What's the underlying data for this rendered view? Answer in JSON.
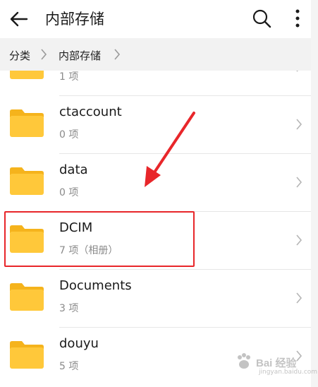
{
  "header": {
    "title": "内部存储"
  },
  "breadcrumb": {
    "root": "分类",
    "current": "内部存储"
  },
  "folders": [
    {
      "name": "",
      "count": "1 项"
    },
    {
      "name": "ctaccount",
      "count": "0 项"
    },
    {
      "name": "data",
      "count": "0 项"
    },
    {
      "name": "DCIM",
      "count": "7 项（相册）"
    },
    {
      "name": "Documents",
      "count": "3 项"
    },
    {
      "name": "douyu",
      "count": "5 项"
    }
  ],
  "watermark": {
    "text": "Bai 经验",
    "sub": "jingyan.baidu.com"
  },
  "colors": {
    "folder": "#ffc83a",
    "folder_tab": "#f5b31c",
    "highlight": "#e8262a",
    "divider": "#e6e6e6",
    "subtext": "#8a8a8a"
  }
}
